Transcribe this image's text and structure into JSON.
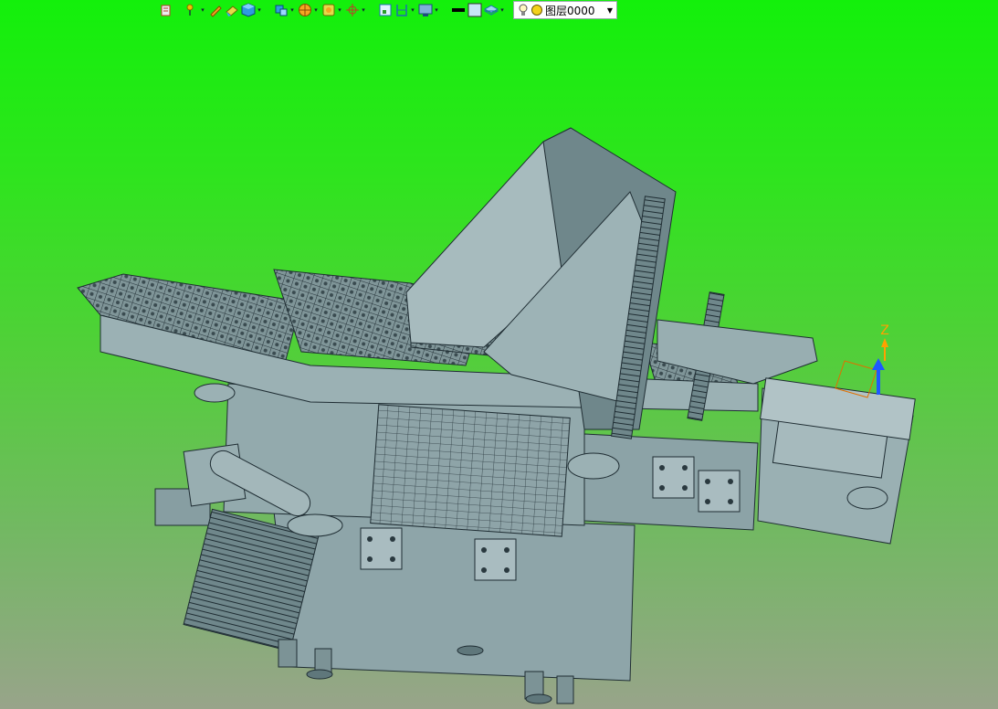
{
  "toolbar": {
    "tools": [
      {
        "icon": "selection-filter-icon",
        "dropdown": false
      },
      {
        "icon": "snap-point-icon",
        "dropdown": true
      },
      {
        "icon": "sketch-pencil-icon",
        "dropdown": false
      },
      {
        "icon": "eraser-icon",
        "dropdown": false
      },
      {
        "icon": "solid-cube-icon",
        "dropdown": true
      },
      {
        "icon": "show-hide-icon",
        "dropdown": true
      },
      {
        "icon": "render-style-icon",
        "dropdown": true
      },
      {
        "icon": "view-orient-icon",
        "dropdown": true
      },
      {
        "icon": "wcs-origin-icon",
        "dropdown": true
      },
      {
        "icon": "fit-view-icon",
        "dropdown": false
      },
      {
        "icon": "section-view-icon",
        "dropdown": true
      },
      {
        "icon": "display-settings-icon",
        "dropdown": true
      },
      {
        "icon": "line-color-icon",
        "dropdown": false
      },
      {
        "icon": "fill-color-icon",
        "dropdown": false
      },
      {
        "icon": "layer-settings-icon",
        "dropdown": true
      }
    ],
    "layer": {
      "value": "图层0000",
      "icons": [
        "bulb-icon",
        "layer-status-icon"
      ]
    }
  },
  "viewport": {
    "axis_label": "Z",
    "colors": {
      "model_fill": "#8fa6aa",
      "model_light": "#a9bcc0",
      "model_dark": "#6d8589",
      "edge": "#1f2d33",
      "axis_z": "#1e58ff",
      "axis_label": "#ffa000"
    }
  }
}
